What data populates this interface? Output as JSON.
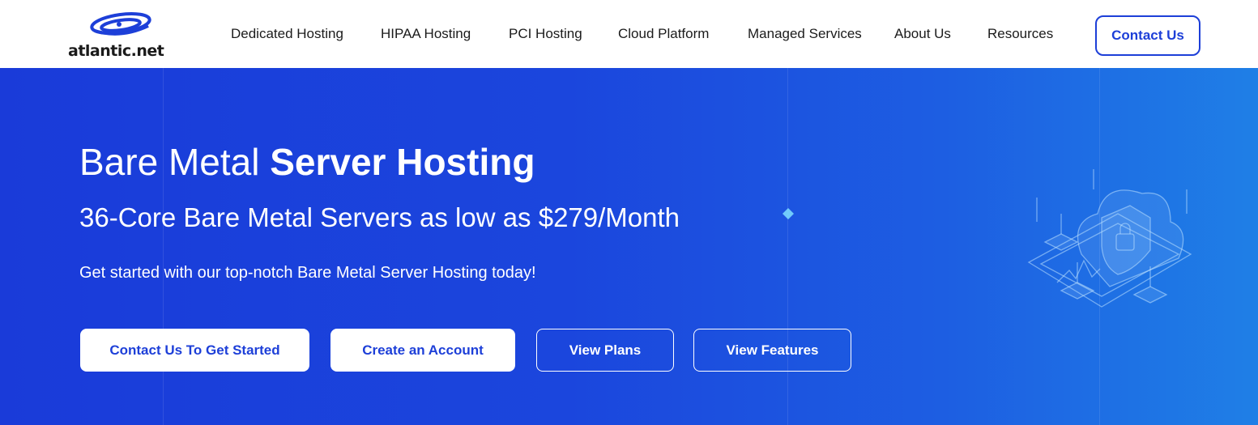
{
  "brand": {
    "logo_text": "atlantic.net",
    "logo_icon": "atlantic-swirl-logo",
    "color": "#1d3fd8"
  },
  "nav": {
    "items": [
      {
        "label": "Dedicated Hosting"
      },
      {
        "label": "HIPAA Hosting"
      },
      {
        "label": "PCI Hosting"
      },
      {
        "label": "Cloud Platform"
      },
      {
        "label": "Managed Services"
      },
      {
        "label": "About Us"
      },
      {
        "label": "Resources"
      }
    ],
    "contact_label": "Contact Us"
  },
  "hero": {
    "title_light": "Bare Metal ",
    "title_bold": "Server Hosting",
    "subtitle": "36-Core Bare Metal Servers as low as $279/Month",
    "description": "Get started with our top-notch Bare Metal Server Hosting today!",
    "buttons": [
      {
        "label": "Contact Us To Get Started",
        "style": "solid"
      },
      {
        "label": "Create an Account",
        "style": "solid"
      },
      {
        "label": "View Plans",
        "style": "outline"
      },
      {
        "label": "View Features",
        "style": "outline"
      }
    ],
    "illustration_icon": "cloud-security-lock-icon",
    "sparkle_icon": "diamond-sparkle-icon"
  },
  "colors": {
    "hero_start": "#1a3bd9",
    "hero_end": "#1f7fe6",
    "accent": "#1d3fd8"
  }
}
